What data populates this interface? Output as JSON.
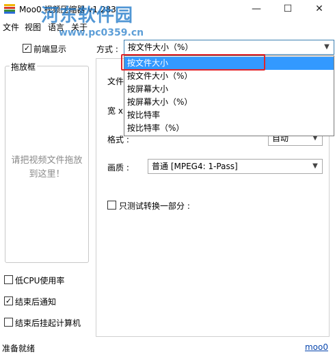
{
  "window": {
    "title": "Moo0 视频压缩器 v1.283",
    "minimize": "—",
    "maximize": "☐",
    "close": "✕",
    "icon_colors": [
      "#f0b400",
      "#d93a2b",
      "#3a8d3a",
      "#2b6bd9"
    ]
  },
  "watermark": {
    "text": "河东软件园",
    "url": "www.pc0359.cn",
    "color": "#1f78c8"
  },
  "menu": {
    "items": [
      "文件",
      "视图",
      "语言",
      "关于"
    ]
  },
  "top": {
    "show_front_label": "前端显示",
    "show_front_checked": true,
    "method_label": "方式 :"
  },
  "method_select": {
    "value": "按文件大小（%）"
  },
  "dropdown": {
    "items": [
      "按文件大小",
      "按文件大小（%）",
      "按屏幕大小",
      "按屏幕大小（%）",
      "按比特率",
      "按比特率（%）"
    ],
    "highlighted_index": 0
  },
  "drop_zone": {
    "title": "拖放框",
    "hint": "请把视频文件拖放到这里！"
  },
  "panel": {
    "file_label": "文件",
    "width_label": "宽 x",
    "format_label": "格式 :",
    "format_value": "自动",
    "quality_label": "画质 :",
    "quality_value": "普通   [MPEG4: 1-Pass]",
    "test_part_label": "只测试转换一部分 :",
    "test_part_checked": false
  },
  "options": [
    {
      "label": "低CPU使用率",
      "checked": false
    },
    {
      "label": "结束后通知",
      "checked": true
    },
    {
      "label": "结束后挂起计算机",
      "checked": false
    }
  ],
  "status": {
    "text": "准备就绪",
    "link": "moo0"
  },
  "accent": {
    "selection": "#3399ff",
    "callout": "#e0242a"
  }
}
